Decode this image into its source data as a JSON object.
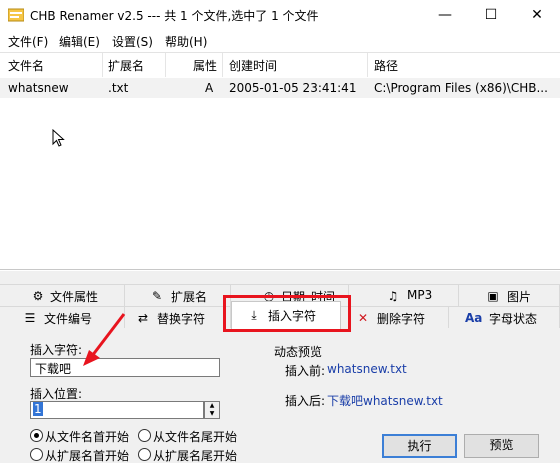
{
  "window": {
    "title": "CHB Renamer v2.5 --- 共 1 个文件,选中了 1 个文件",
    "minimize": "—",
    "maximize": "☐",
    "close": "✕"
  },
  "menu": [
    "文件(F)",
    "编辑(E)",
    "设置(S)",
    "帮助(H)"
  ],
  "table": {
    "columns": [
      "文件名",
      "扩展名",
      "属性",
      "创建时间",
      "路径"
    ],
    "rows": [
      [
        "whatsnew",
        ".txt",
        "A",
        "2005-01-05 23:41:41",
        "C:\\Program Files (x86)\\CHB..."
      ]
    ]
  },
  "tabs_row1": [
    {
      "label": "文件属性",
      "icon": "gear-icon"
    },
    {
      "label": "扩展名",
      "icon": "edit-icon"
    },
    {
      "label": "日期_时间",
      "icon": "clock-icon"
    },
    {
      "label": "MP3",
      "icon": "music-icon"
    },
    {
      "label": "图片",
      "icon": "image-icon"
    }
  ],
  "tabs_row2": [
    {
      "label": "文件编号",
      "icon": "numbered-list-icon"
    },
    {
      "label": "替换字符",
      "icon": "replace-icon"
    },
    {
      "label": "插入字符",
      "icon": "insert-download-icon"
    },
    {
      "label": "删除字符",
      "icon": "delete-x-icon"
    },
    {
      "label": "字母状态",
      "icon": "letter-case-icon",
      "icon_text": "Aa"
    }
  ],
  "insert": {
    "char_label": "插入字符:",
    "char_value": "下载吧",
    "pos_label": "插入位置:",
    "pos_value": "1",
    "radio_from_name_start": "从文件名首开始",
    "radio_from_name_end": "从文件名尾开始",
    "radio_from_ext_start": "从扩展名首开始",
    "radio_from_ext_end": "从扩展名尾开始",
    "selected_radio": "从文件名首开始"
  },
  "preview": {
    "title": "动态预览",
    "before_label": "插入前:",
    "before_value": "whatsnew.txt",
    "after_label": "插入后:",
    "after_value": "下载吧whatsnew.txt"
  },
  "buttons": {
    "execute": "执行",
    "preview": "预览"
  },
  "colors": {
    "highlight": "#e8141e",
    "preview_value": "#1a3ea8",
    "annotation_arrow": "#e8141e"
  }
}
